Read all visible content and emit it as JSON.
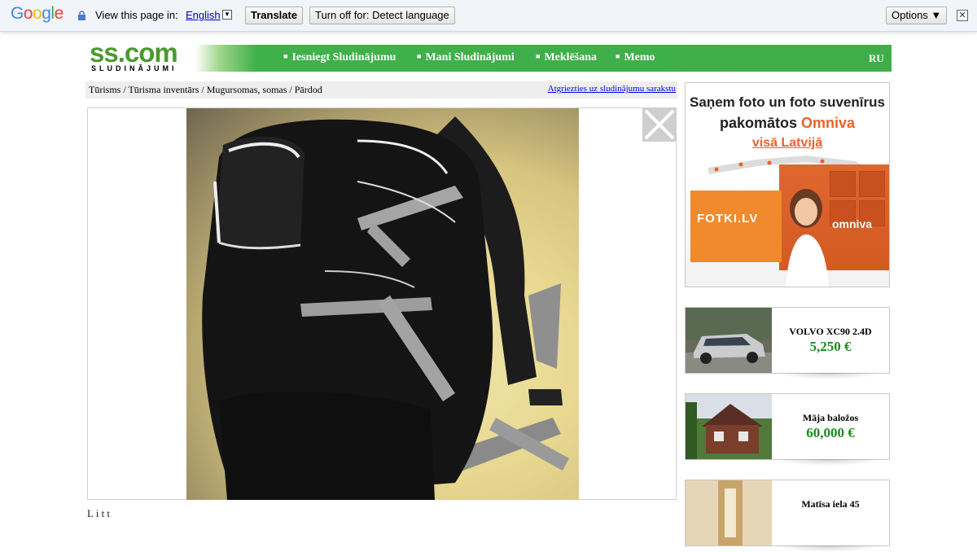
{
  "translate_bar": {
    "logo": "Google",
    "view_label": "View this page in:",
    "language": "English",
    "translate_button": "Translate",
    "turn_off_button": "Turn off for: Detect language",
    "options_button": "Options ▼",
    "close_glyph": "✕"
  },
  "header": {
    "logo": "ss.com",
    "logo_sub": "SLUDINĀJUMI",
    "menu": [
      "Iesniegt Sludinājumu",
      "Mani Sludinājumi",
      "Meklēšana",
      "Memo"
    ],
    "lang": "RU"
  },
  "breadcrumb": {
    "path": "Tūrisms / Tūrisma inventārs / Mugursomas, somas / Pārdod",
    "back_link": "Atgriezties uz sludinājumu sarakstu"
  },
  "listing": {
    "photo_alt": "black backpack",
    "description_partial": "L i t t"
  },
  "banner": {
    "line1": "Saņem foto un foto suvenīrus",
    "line2_prefix": "pakomātos ",
    "line2_brand": "Omniva",
    "line3": "visā Latvijā",
    "fotki": "FOTKI.LV",
    "omniva_logo": "omniva"
  },
  "ads": [
    {
      "title": "VOLVO XC90 2.4D",
      "price": "5,250 €"
    },
    {
      "title": "Māja baložos",
      "price": "60,000 €"
    },
    {
      "title": "Matīsa iela 45",
      "price": ""
    }
  ],
  "colors": {
    "menu_green": "#3fae49",
    "price_green": "#1a8a1a",
    "omniva_orange": "#e8632b"
  }
}
